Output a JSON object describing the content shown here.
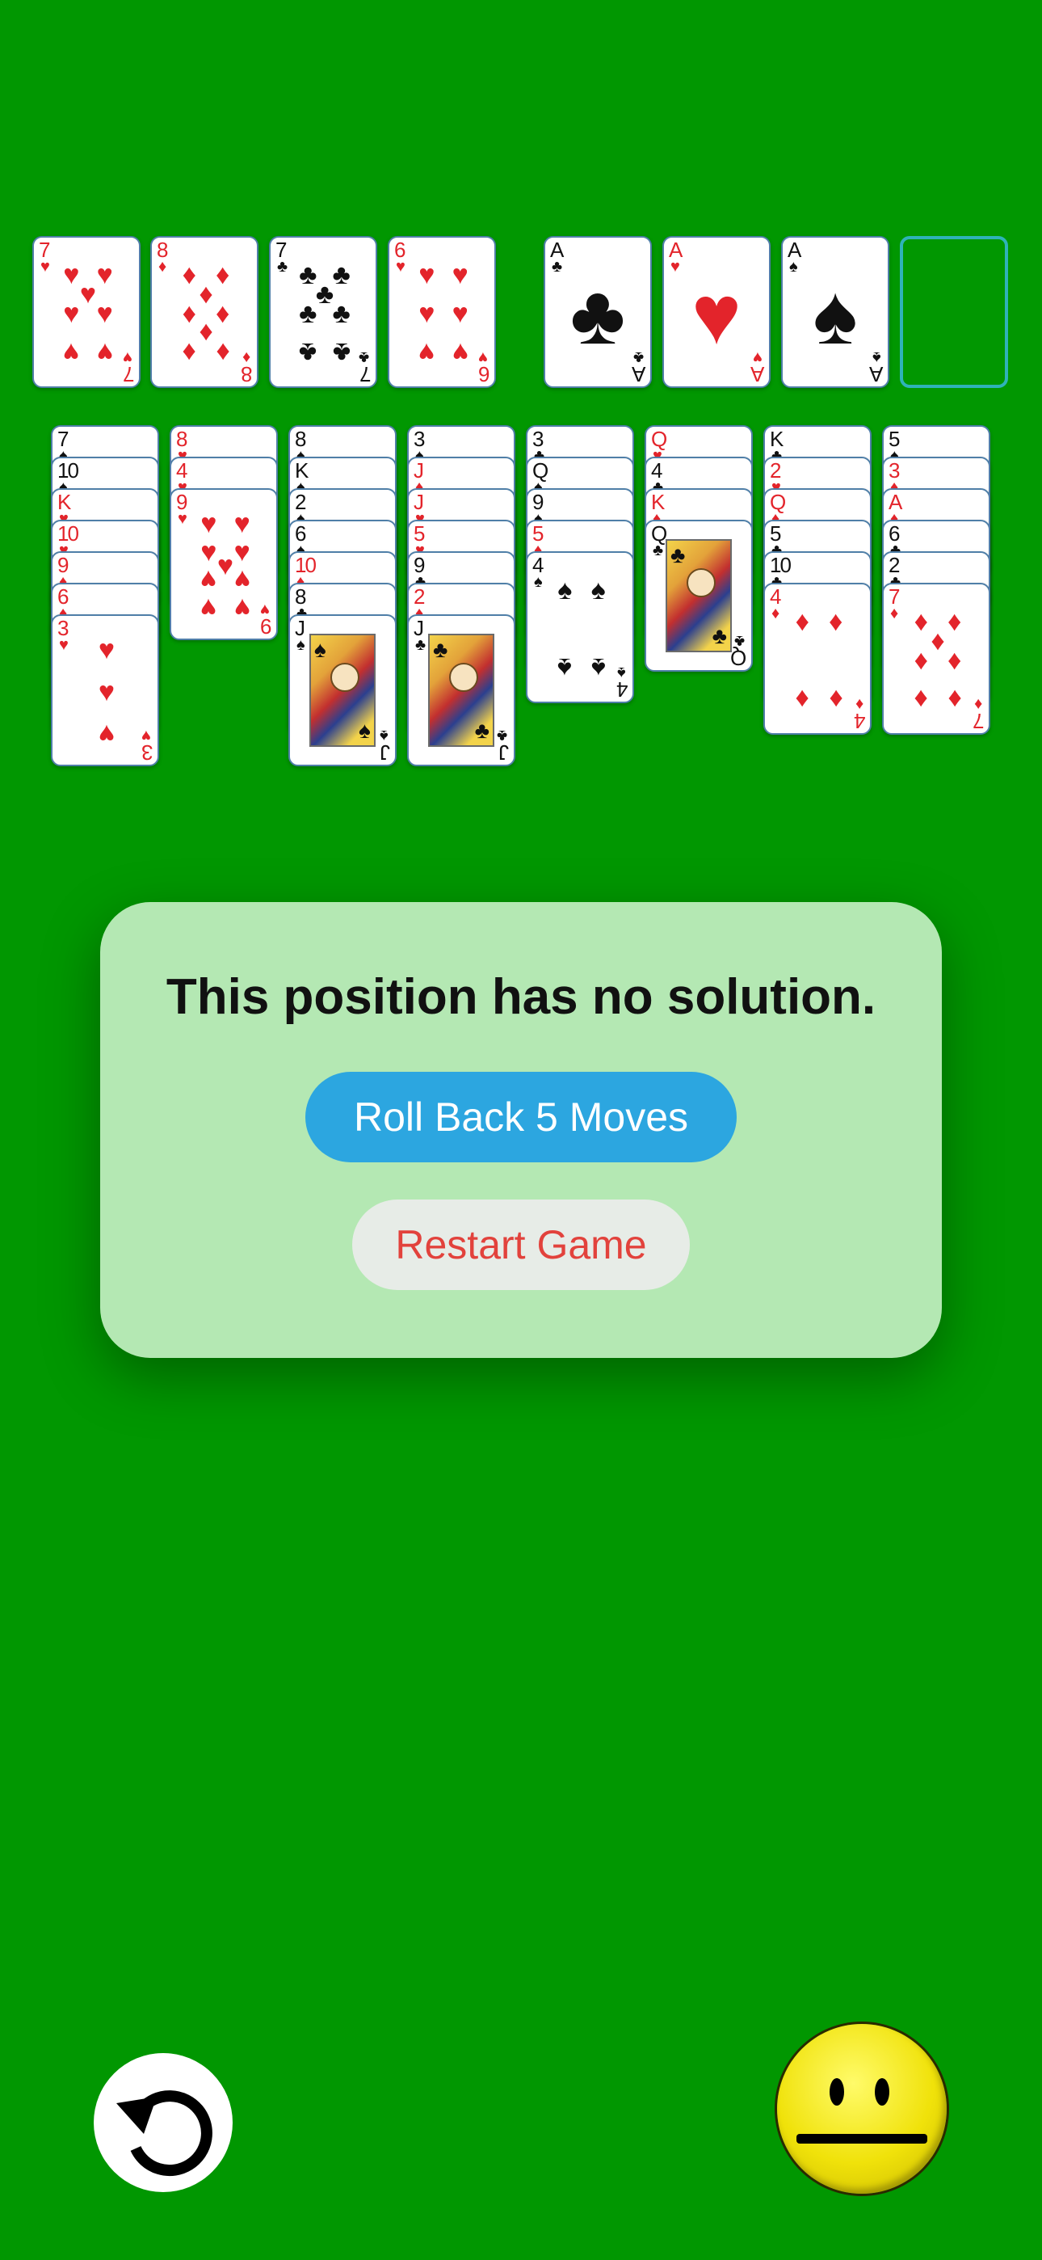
{
  "freecells": [
    {
      "rank": "7",
      "suit": "♥",
      "color": "red"
    },
    {
      "rank": "8",
      "suit": "♦",
      "color": "red"
    },
    {
      "rank": "7",
      "suit": "♣",
      "color": "black"
    },
    {
      "rank": "6",
      "suit": "♥",
      "color": "red"
    }
  ],
  "foundations": [
    {
      "rank": "A",
      "suit": "♣",
      "color": "black"
    },
    {
      "rank": "A",
      "suit": "♥",
      "color": "red"
    },
    {
      "rank": "A",
      "suit": "♠",
      "color": "black"
    },
    null
  ],
  "tableau": [
    [
      {
        "rank": "7",
        "suit": "♠",
        "color": "black"
      },
      {
        "rank": "10",
        "suit": "♠",
        "color": "black"
      },
      {
        "rank": "K",
        "suit": "♥",
        "color": "red"
      },
      {
        "rank": "10",
        "suit": "♥",
        "color": "red"
      },
      {
        "rank": "9",
        "suit": "♦",
        "color": "red"
      },
      {
        "rank": "6",
        "suit": "♦",
        "color": "red"
      },
      {
        "rank": "3",
        "suit": "♥",
        "color": "red"
      }
    ],
    [
      {
        "rank": "8",
        "suit": "♥",
        "color": "red"
      },
      {
        "rank": "4",
        "suit": "♥",
        "color": "red"
      },
      {
        "rank": "9",
        "suit": "♥",
        "color": "red"
      }
    ],
    [
      {
        "rank": "8",
        "suit": "♠",
        "color": "black"
      },
      {
        "rank": "K",
        "suit": "♠",
        "color": "black"
      },
      {
        "rank": "2",
        "suit": "♠",
        "color": "black"
      },
      {
        "rank": "6",
        "suit": "♠",
        "color": "black"
      },
      {
        "rank": "10",
        "suit": "♦",
        "color": "red"
      },
      {
        "rank": "8",
        "suit": "♣",
        "color": "black"
      },
      {
        "rank": "J",
        "suit": "♠",
        "color": "black"
      }
    ],
    [
      {
        "rank": "3",
        "suit": "♠",
        "color": "black"
      },
      {
        "rank": "J",
        "suit": "♦",
        "color": "red"
      },
      {
        "rank": "J",
        "suit": "♥",
        "color": "red"
      },
      {
        "rank": "5",
        "suit": "♥",
        "color": "red"
      },
      {
        "rank": "9",
        "suit": "♣",
        "color": "black"
      },
      {
        "rank": "2",
        "suit": "♦",
        "color": "red"
      },
      {
        "rank": "J",
        "suit": "♣",
        "color": "black"
      }
    ],
    [
      {
        "rank": "3",
        "suit": "♣",
        "color": "black"
      },
      {
        "rank": "Q",
        "suit": "♠",
        "color": "black"
      },
      {
        "rank": "9",
        "suit": "♠",
        "color": "black"
      },
      {
        "rank": "5",
        "suit": "♦",
        "color": "red"
      },
      {
        "rank": "4",
        "suit": "♠",
        "color": "black"
      }
    ],
    [
      {
        "rank": "Q",
        "suit": "♥",
        "color": "red"
      },
      {
        "rank": "4",
        "suit": "♣",
        "color": "black"
      },
      {
        "rank": "K",
        "suit": "♦",
        "color": "red"
      },
      {
        "rank": "Q",
        "suit": "♣",
        "color": "black"
      }
    ],
    [
      {
        "rank": "K",
        "suit": "♣",
        "color": "black"
      },
      {
        "rank": "2",
        "suit": "♥",
        "color": "red"
      },
      {
        "rank": "Q",
        "suit": "♦",
        "color": "red"
      },
      {
        "rank": "5",
        "suit": "♣",
        "color": "black"
      },
      {
        "rank": "10",
        "suit": "♣",
        "color": "black"
      },
      {
        "rank": "4",
        "suit": "♦",
        "color": "red"
      }
    ],
    [
      {
        "rank": "5",
        "suit": "♠",
        "color": "black"
      },
      {
        "rank": "3",
        "suit": "♦",
        "color": "red"
      },
      {
        "rank": "A",
        "suit": "♦",
        "color": "red"
      },
      {
        "rank": "6",
        "suit": "♣",
        "color": "black"
      },
      {
        "rank": "2",
        "suit": "♣",
        "color": "black"
      },
      {
        "rank": "7",
        "suit": "♦",
        "color": "red"
      }
    ]
  ],
  "modal": {
    "title": "This position has no solution.",
    "rollback_label": "Roll Back 5 Moves",
    "restart_label": "Restart Game"
  },
  "controls": {
    "undo_icon": "undo-arrow-icon",
    "status_icon": "neutral-face-icon"
  },
  "colors": {
    "felt": "#019701",
    "red_suit": "#e3242b",
    "black_suit": "#111111",
    "modal_bg": "#b4e8b3",
    "primary_button": "#2ca6e0",
    "destructive_text": "#e2423c"
  }
}
